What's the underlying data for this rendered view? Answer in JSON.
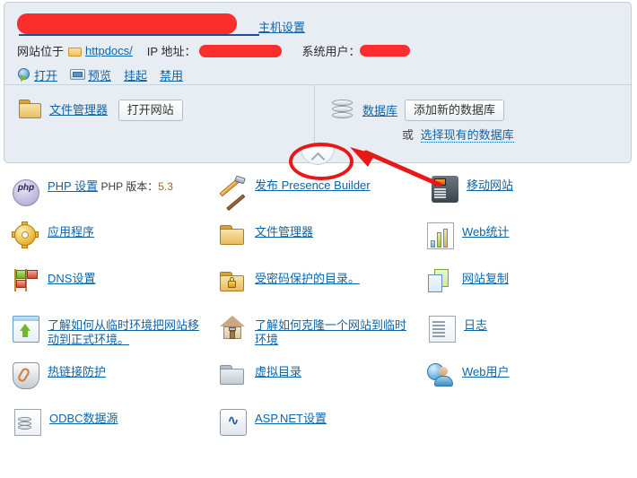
{
  "panel": {
    "site_title_redacted": true,
    "host_settings_link": "主机设置",
    "location_label": "网站位于",
    "location_path": "httpdocs/",
    "ip_label": "IP 地址：",
    "system_user_label": "系统用户：",
    "actions": [
      {
        "label": "打开",
        "icon": "globe-arrow-icon"
      },
      {
        "label": "预览",
        "icon": "monitor-icon"
      },
      {
        "label": "挂起",
        "icon": null
      },
      {
        "label": "禁用",
        "icon": null
      }
    ],
    "file_manager": {
      "link": "文件管理器",
      "button": "打开网站",
      "icon": "folder-icon"
    },
    "database": {
      "link": "数据库",
      "button": "添加新的数据库",
      "or_text": "或",
      "existing_link": "选择现有的数据库",
      "icon": "database-icon"
    },
    "collapse_label": "chevron-up-icon"
  },
  "tools": [
    [
      {
        "label": "PHP 设置",
        "sub_prefix": "PHP 版本：",
        "sub_value": "5.3",
        "icon": "php-icon",
        "name": "php-settings"
      },
      {
        "label": "发布 Presence Builder",
        "icon": "hammer-pencil-icon",
        "name": "presence-builder"
      },
      {
        "label": "移动网站",
        "icon": "mobile-phone-icon",
        "name": "mobile-site"
      }
    ],
    [
      {
        "label": "应用程序",
        "icon": "gear-icon",
        "name": "applications"
      },
      {
        "label": "文件管理器",
        "icon": "folder-icon",
        "name": "file-manager"
      },
      {
        "label": "Web统计",
        "icon": "bar-chart-icon",
        "name": "web-statistics"
      }
    ],
    [
      {
        "label": "DNS设置",
        "icon": "dns-flags-icon",
        "name": "dns-settings"
      },
      {
        "label": "受密码保护的目录。",
        "icon": "locked-folder-icon",
        "name": "protected-directories"
      },
      {
        "label": "网站复制",
        "icon": "copy-pages-icon",
        "name": "website-copying"
      }
    ],
    [
      {
        "label": "了解如何从临时环境把网站移动到正式环境。",
        "icon": "upload-window-icon",
        "name": "move-site-to-production"
      },
      {
        "label": "了解如何克隆一个网站到临时环境",
        "icon": "house-icon",
        "name": "clone-site-to-staging"
      },
      {
        "label": "日志",
        "icon": "document-lines-icon",
        "name": "logs"
      }
    ],
    [
      {
        "label": "热链接防护",
        "icon": "shield-link-icon",
        "name": "hotlink-protection"
      },
      {
        "label": "虚拟目录",
        "icon": "grey-folder-icon",
        "name": "virtual-directories"
      },
      {
        "label": "Web用户",
        "icon": "globe-user-icon",
        "name": "web-users"
      }
    ],
    [
      {
        "label": "ODBC数据源",
        "icon": "odbc-document-icon",
        "name": "odbc-data-sources"
      },
      {
        "label": "ASP.NET设置",
        "icon": "aspnet-icon",
        "name": "aspnet-settings"
      },
      {
        "label": "",
        "icon": null,
        "name": "empty"
      }
    ]
  ],
  "colors": {
    "link": "#1064a8",
    "panel_bg": "#e7edf2",
    "panel_border": "#c3cdd6",
    "annotation_red": "#e81818",
    "redaction_red": "#fb2d2d"
  }
}
